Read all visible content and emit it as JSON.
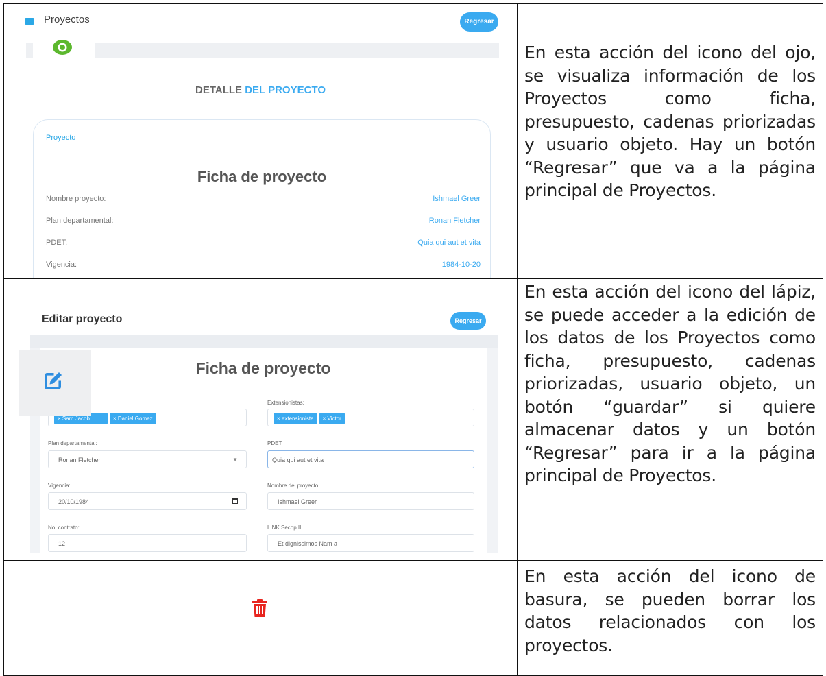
{
  "row1": {
    "screenshot": {
      "top_title": "Proyectos",
      "regresar_label": "Regresar",
      "eye_icon": "eye-icon",
      "detalle_prefix": "DETALLE ",
      "detalle_highlight": "DEL PROYECTO",
      "card_tag": "Proyecto",
      "card_title": "Ficha de proyecto",
      "rows": [
        {
          "label": "Nombre proyecto:",
          "value": "Ishmael Greer"
        },
        {
          "label": "Plan departamental:",
          "value": "Ronan Fletcher"
        },
        {
          "label": "PDET:",
          "value": "Quia qui aut et vita"
        },
        {
          "label": "Vigencia:",
          "value": "1984-10-20"
        }
      ],
      "accent_color": "#3aaaf0",
      "eye_color": "#5cb82e"
    },
    "description": "En esta acción del icono del ojo, se visualiza información de los Proyectos como ficha, presupuesto, cadenas priorizadas y usuario objeto. Hay un botón “Regresar” que va a la página principal de Proyectos."
  },
  "row2": {
    "screenshot": {
      "title": "Editar proyecto",
      "regresar_label": "Regresar",
      "form_title": "Ficha de proyecto",
      "pencil_icon": "edit-pencil-icon",
      "extensionistas_label": "Extensionistas:",
      "chips_left": [
        "× Sam Jacob",
        "× Daniel Gomez"
      ],
      "chips_right": [
        "× extensionista",
        "× Victor"
      ],
      "plan_label": "Plan departamental:",
      "plan_value": "Ronan Fletcher",
      "pdet_label": "PDET:",
      "pdet_value": "Quia qui aut et vita",
      "vigencia_label": "Vigencia:",
      "vigencia_value": "20/10/1984",
      "nombre_label": "Nombre del proyecto:",
      "nombre_value": "Ishmael Greer",
      "contrato_label": "No. contrato:",
      "contrato_value": "12",
      "secop_label": "LINK Secop II:",
      "secop_value": "Et dignissimos Nam a"
    },
    "description": "En esta acción del icono del lápiz, se puede acceder a la edición de los datos de los Proyectos como ficha, presupuesto, cadenas priorizadas, usuario objeto, un botón “guardar” si quiere almacenar datos y un botón “Regresar” para ir a la página principal de Proyectos."
  },
  "row3": {
    "trash_icon": "trash-icon",
    "trash_color": "#e8251f",
    "description": "En esta acción del icono de basura, se pueden borrar los datos relacionados con los proyectos."
  }
}
